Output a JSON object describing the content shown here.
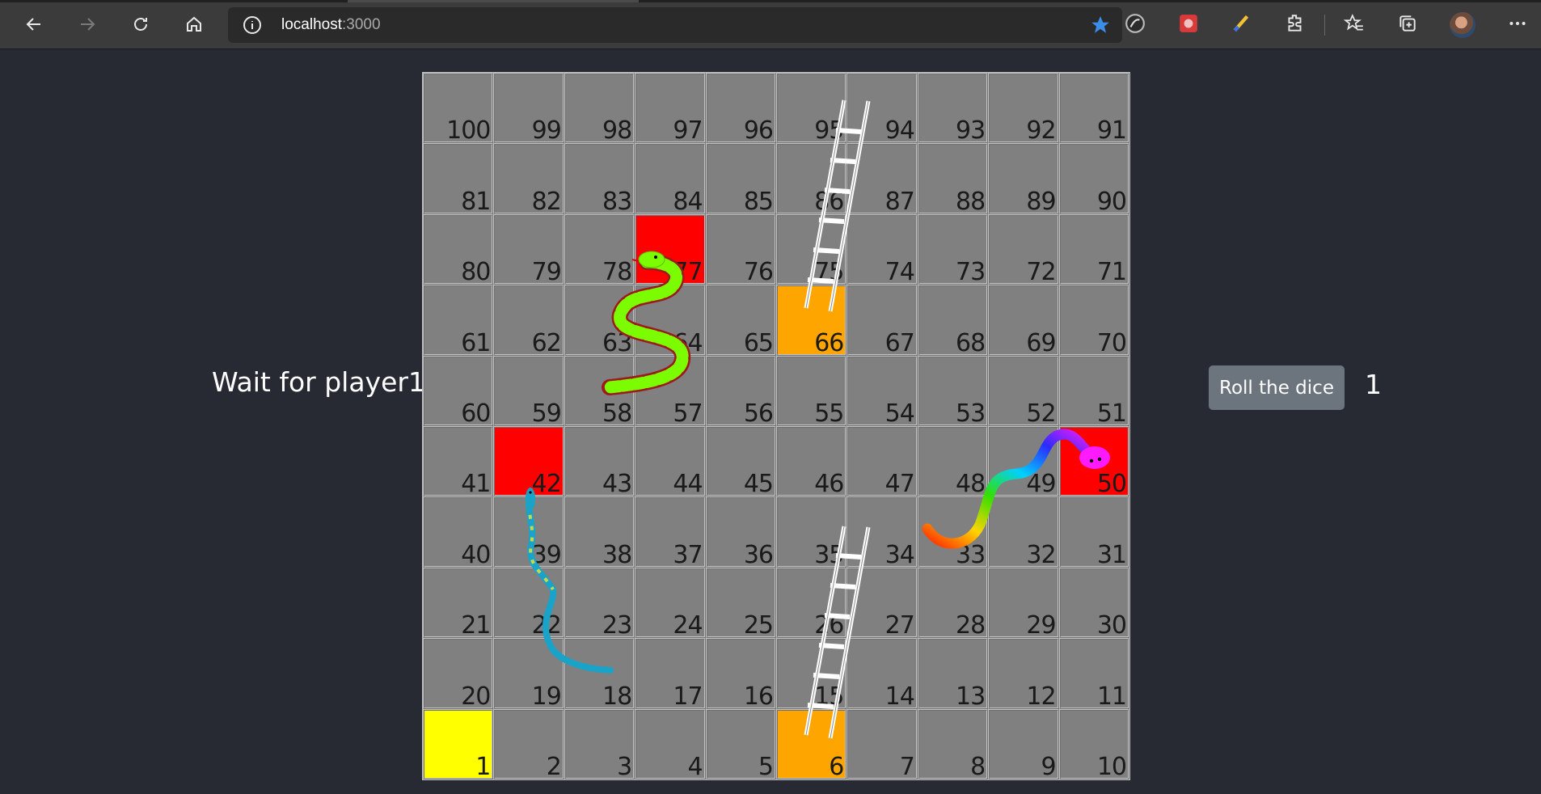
{
  "browser": {
    "url_host": "localhost",
    "url_port": ":3000",
    "icons": [
      "back-icon",
      "forward-icon",
      "reload-icon",
      "home-icon",
      "info-icon",
      "favorite-star-icon",
      "extension-icon-1",
      "extension-icon-2",
      "extension-icon-3",
      "extensions-puzzle-icon",
      "favorites-icon",
      "collections-icon",
      "profile-avatar",
      "more-icon"
    ]
  },
  "game": {
    "status_text": "Wait for player1",
    "roll_button_label": "Roll the dice",
    "dice_value": "1"
  },
  "board": {
    "rows": [
      [
        100,
        99,
        98,
        97,
        96,
        95,
        94,
        93,
        92,
        91
      ],
      [
        81,
        82,
        83,
        84,
        85,
        86,
        87,
        88,
        89,
        90
      ],
      [
        80,
        79,
        78,
        77,
        76,
        75,
        74,
        73,
        72,
        71
      ],
      [
        61,
        62,
        63,
        64,
        65,
        66,
        67,
        68,
        69,
        70
      ],
      [
        60,
        59,
        58,
        57,
        56,
        55,
        54,
        53,
        52,
        51
      ],
      [
        41,
        42,
        43,
        44,
        45,
        46,
        47,
        48,
        49,
        50
      ],
      [
        40,
        39,
        38,
        37,
        36,
        35,
        34,
        33,
        32,
        31
      ],
      [
        21,
        22,
        23,
        24,
        25,
        26,
        27,
        28,
        29,
        30
      ],
      [
        20,
        19,
        18,
        17,
        16,
        15,
        14,
        13,
        12,
        11
      ],
      [
        1,
        2,
        3,
        4,
        5,
        6,
        7,
        8,
        9,
        10
      ]
    ],
    "highlight": {
      "red": [
        77,
        42,
        50
      ],
      "orange": [
        66,
        6
      ],
      "yellow": [
        1
      ]
    },
    "ladders": [
      {
        "from": 66,
        "to": 94
      },
      {
        "from": 6,
        "to": 34
      }
    ],
    "snakes": [
      {
        "head": 77,
        "tail": 57,
        "color": "#7cfc00"
      },
      {
        "head": 50,
        "tail": 33,
        "color": "rainbow"
      },
      {
        "head": 42,
        "tail": 18,
        "color": "#1aa3c8"
      }
    ]
  },
  "colors": {
    "page_bg": "#272a33",
    "cell": "#808080",
    "red": "#ff0000",
    "orange": "#ffa500",
    "yellow": "#ffff00",
    "button": "#6c757d"
  }
}
